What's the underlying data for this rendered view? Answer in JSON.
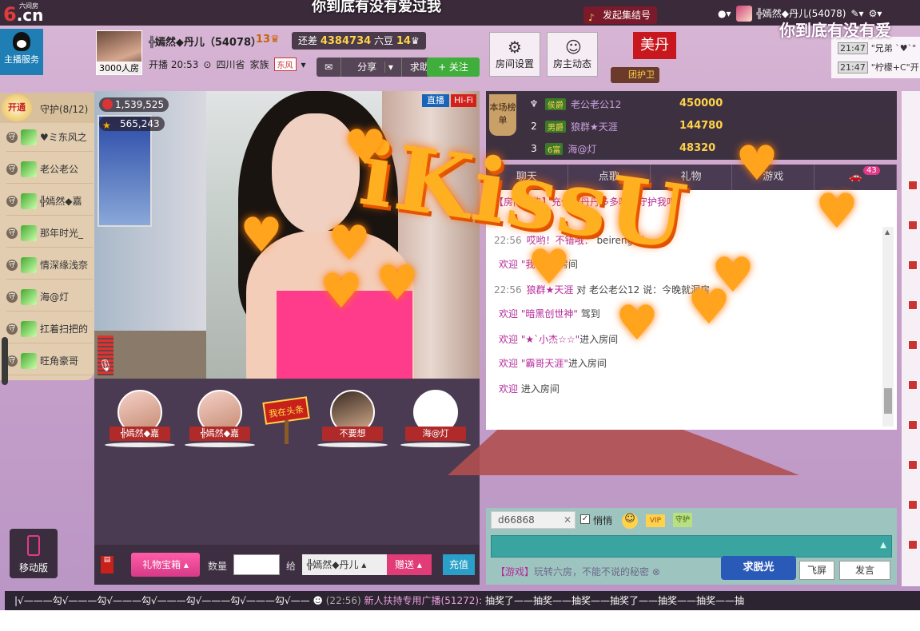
{
  "top": {
    "logo_six": "6",
    "logo_cn": ".cn",
    "logo_sub": "六间房",
    "marquee": "你到底有没有爱过我",
    "gather_label": "发起集结号",
    "user_label": "╬嫣然◆丹儿(54078)",
    "marquee_right": "你到底有没有爱"
  },
  "service": {
    "label": "主播服务"
  },
  "host": {
    "rooms": "3000人房",
    "name": "╬嫣然◆丹儿（54078）",
    "level": "13",
    "coin_prefix": "还差",
    "coin_value": "4384734",
    "coin_suffix": "六豆",
    "coin_level": "14",
    "start_label": "开播 20:53",
    "location": "四川省",
    "clan_label": "家族",
    "clan_tag": "东风",
    "share": "分享",
    "help": "求助",
    "follow": "+ 关注",
    "room_settings": "房间设置",
    "host_news": "房主动态",
    "meidan": "美丹",
    "guard_group": "团护卫"
  },
  "guard": {
    "open": "开通",
    "title": "守护(8/12)",
    "items": [
      {
        "name": "♥ミ东风之"
      },
      {
        "name": "老公老公"
      },
      {
        "name": "╬嫣然◆嘉"
      },
      {
        "name": "那年时光_"
      },
      {
        "name": "情深缘浅奈"
      },
      {
        "name": "海@灯"
      },
      {
        "name": "扛着扫把的"
      },
      {
        "name": "旺角豪哥"
      }
    ]
  },
  "mobile": {
    "label": "移动版"
  },
  "video": {
    "wealth": "1,539,525",
    "fans": "565,243",
    "live": "直播",
    "hifi": "Hi-Fi"
  },
  "seats": [
    {
      "name": "╬嫣然◆嘉"
    },
    {
      "name": "╬嫣然◆嘉"
    },
    {
      "name": "不要想"
    },
    {
      "name": "海@灯"
    }
  ],
  "sign": "我在头条",
  "gift": {
    "treasure": "礼物宝箱",
    "qty_label": "数量",
    "to_label": "给",
    "recipient": "╬嫣然◆丹儿",
    "send": "赠送",
    "recharge": "充值"
  },
  "rank": {
    "tag": "本场榜单",
    "rows": [
      {
        "num": "1",
        "badge": "侯爵",
        "name": "老公老公12",
        "value": "450000"
      },
      {
        "num": "2",
        "badge": "男爵",
        "name": "狼群★天涯",
        "value": "144780"
      },
      {
        "num": "3",
        "badge": "6富",
        "name": "海@灯",
        "value": "48320"
      }
    ]
  },
  "tabs": [
    "聊天",
    "点歌",
    "礼物",
    "游戏",
    ""
  ],
  "car_count": "43",
  "chat": {
    "notice": "【房间公告】充值找丹丹多多哦，守护我吧",
    "lines": [
      {
        "time": "22:56",
        "user": "哎哟！不错哦：",
        "text": "beirengzd"
      },
      {
        "time": "",
        "user": "欢迎 \"我\"",
        "text": "进入房间"
      },
      {
        "time": "22:56",
        "user": "狼群★天涯",
        "text": "对 老公老公12 说：今晚就洞房"
      },
      {
        "time": "",
        "user": "欢迎 \"暗黑创世神\"",
        "text": "驾到"
      },
      {
        "time": "",
        "user": "欢迎 \"★`小杰☆☆\"",
        "text": "进入房间"
      },
      {
        "time": "",
        "user": "欢迎 \"霸哥天涯\"",
        "text": "进入房间"
      },
      {
        "time": "",
        "user": "欢迎 ",
        "text": "进入房间"
      }
    ]
  },
  "input": {
    "user_field": "d66868",
    "whisper": "悄悄",
    "vip": "VIP",
    "guard_emo": "守护",
    "game_tip_tag": "【游戏】",
    "game_tip": "玩转六房，不能不说的秘密",
    "fly": "飞屏",
    "send": "发言",
    "qiutuoguang": "求脱光"
  },
  "danmu": [
    {
      "time": "21:47",
      "text": "\"兄弟 `♥`\""
    },
    {
      "time": "21:47",
      "text": "\"柠檬+C\"开"
    }
  ],
  "ticker": {
    "lead": "|√———勾√———勾√———勾√———勾√———勾√———勾√——",
    "time": "(22:56)",
    "broadcast": "新人扶持专用广播(51272):",
    "body": "抽奖了——抽奖——抽奖——抽奖了——抽奖——抽奖——抽"
  },
  "overlay": {
    "kiss": "iKissU"
  }
}
